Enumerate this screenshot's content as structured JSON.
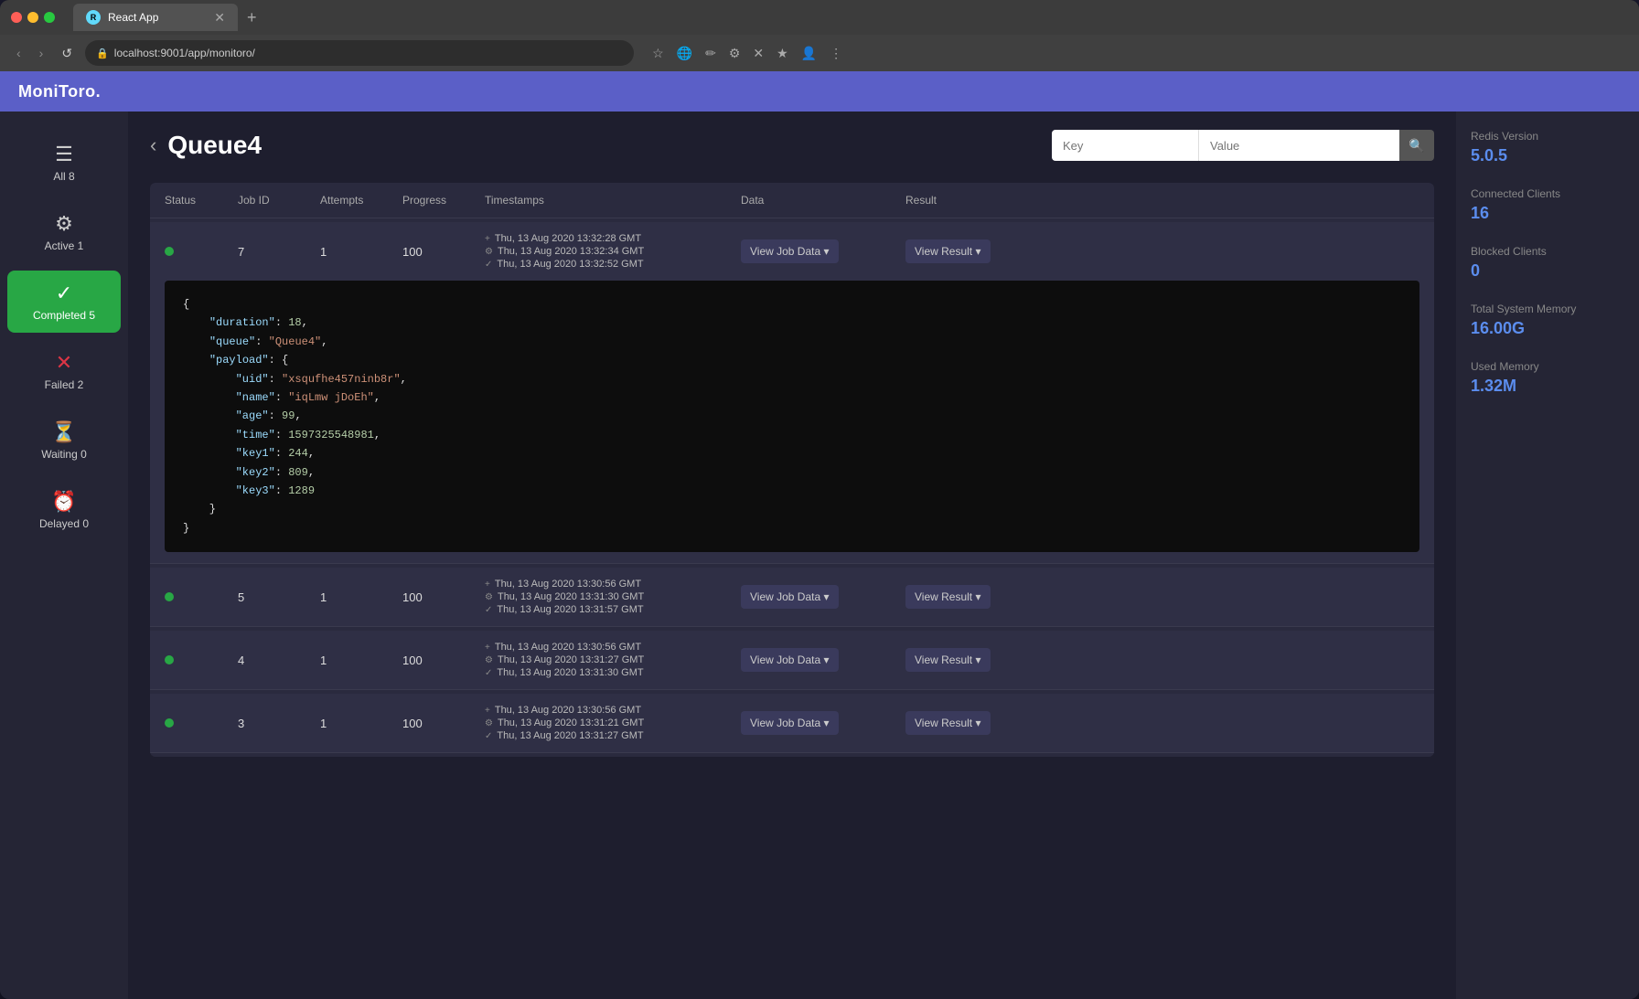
{
  "browser": {
    "tab_title": "React App",
    "url": "localhost:9001/app/monitoro/",
    "new_tab_icon": "+",
    "nav_back": "‹",
    "nav_forward": "›",
    "nav_reload": "↺"
  },
  "app": {
    "logo": "MoniToro.",
    "page_title": "Queue4",
    "back_icon": "‹",
    "search": {
      "key_placeholder": "Key",
      "value_placeholder": "Value"
    }
  },
  "sidebar": {
    "items": [
      {
        "id": "all",
        "label": "All",
        "badge": "8",
        "icon": "☰",
        "active": false
      },
      {
        "id": "active",
        "label": "Active",
        "badge": "1",
        "icon": "⚙",
        "active": false
      },
      {
        "id": "completed",
        "label": "Completed",
        "badge": "5",
        "icon": "✓",
        "active": true
      },
      {
        "id": "failed",
        "label": "Failed",
        "badge": "2",
        "icon": "✕",
        "active": false
      },
      {
        "id": "waiting",
        "label": "Waiting",
        "badge": "0",
        "icon": "⏳",
        "active": false
      },
      {
        "id": "delayed",
        "label": "Delayed",
        "badge": "0",
        "icon": "⏰",
        "active": false
      }
    ]
  },
  "table": {
    "columns": [
      "Status",
      "Job ID",
      "Attempts",
      "Progress",
      "Timestamps",
      "Data",
      "Result"
    ],
    "rows": [
      {
        "id": "7",
        "attempts": "1",
        "progress": "100",
        "timestamps": [
          {
            "icon": "+",
            "text": "Thu, 13 Aug 2020 13:32:28 GMT"
          },
          {
            "icon": "⚙",
            "text": "Thu, 13 Aug 2020 13:32:34 GMT"
          },
          {
            "icon": "✓",
            "text": "Thu, 13 Aug 2020 13:32:52 GMT"
          }
        ],
        "data_btn": "View Job Data ▾",
        "result_btn": "View Result ▾",
        "expanded": true,
        "json": "{\n    \"duration\": 18,\n    \"queue\": \"Queue4\",\n    \"payload\": {\n        \"uid\": \"xsqufhe457ninb8r\",\n        \"name\": \"iqLmw jDoEh\",\n        \"age\": 99,\n        \"time\": 1597325548981,\n        \"key1\": 244,\n        \"key2\": 809,\n        \"key3\": 1289\n    }\n}"
      },
      {
        "id": "5",
        "attempts": "1",
        "progress": "100",
        "timestamps": [
          {
            "icon": "+",
            "text": "Thu, 13 Aug 2020 13:30:56 GMT"
          },
          {
            "icon": "⚙",
            "text": "Thu, 13 Aug 2020 13:31:30 GMT"
          },
          {
            "icon": "✓",
            "text": "Thu, 13 Aug 2020 13:31:57 GMT"
          }
        ],
        "data_btn": "View Job Data ▾",
        "result_btn": "View Result ▾",
        "expanded": false
      },
      {
        "id": "4",
        "attempts": "1",
        "progress": "100",
        "timestamps": [
          {
            "icon": "+",
            "text": "Thu, 13 Aug 2020 13:30:56 GMT"
          },
          {
            "icon": "⚙",
            "text": "Thu, 13 Aug 2020 13:31:27 GMT"
          },
          {
            "icon": "✓",
            "text": "Thu, 13 Aug 2020 13:31:30 GMT"
          }
        ],
        "data_btn": "View Job Data ▾",
        "result_btn": "View Result ▾",
        "expanded": false
      },
      {
        "id": "3",
        "attempts": "1",
        "progress": "100",
        "timestamps": [
          {
            "icon": "+",
            "text": "Thu, 13 Aug 2020 13:30:56 GMT"
          },
          {
            "icon": "⚙",
            "text": "Thu, 13 Aug 2020 13:31:21 GMT"
          },
          {
            "icon": "✓",
            "text": "Thu, 13 Aug 2020 13:31:27 GMT"
          }
        ],
        "data_btn": "View Job Data ▾",
        "result_btn": "View Result ▾",
        "expanded": false
      }
    ]
  },
  "right_panel": {
    "stats": [
      {
        "label": "Redis Version",
        "value": "5.0.5"
      },
      {
        "label": "Connected Clients",
        "value": "16"
      },
      {
        "label": "Blocked Clients",
        "value": "0"
      },
      {
        "label": "Total System Memory",
        "value": "16.00G"
      },
      {
        "label": "Used Memory",
        "value": "1.32M"
      }
    ]
  }
}
